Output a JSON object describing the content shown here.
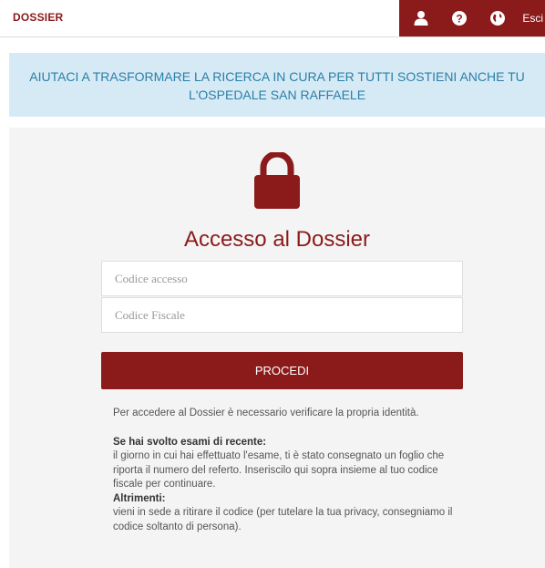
{
  "header": {
    "brand": "DOSSIER",
    "nav": {
      "user_icon": "user-icon",
      "help_icon": "question-circle-icon",
      "language_icon": "globe-icon",
      "exit_label": "Esci"
    }
  },
  "banner": {
    "text": "AIUTACI A TRASFORMARE LA RICERCA IN CURA PER TUTTI SOSTIENI ANCHE TU L'OSPEDALE SAN RAFFAELE"
  },
  "login": {
    "lock_icon": "padlock-icon",
    "title": "Accesso al Dossier",
    "access_code_placeholder": "Codice accesso",
    "access_code_value": "",
    "fiscal_code_placeholder": "Codice Fiscale",
    "fiscal_code_value": "",
    "submit_label": "PROCEDI"
  },
  "info": {
    "intro": "Per accedere al Dossier è necessario verificare la propria identità.",
    "recent_heading": "Se hai svolto esami di recente:",
    "recent_text": "il giorno in cui hai effettuato l'esame, ti è stato consegnato un foglio che riporta il numero del referto. Inseriscilo qui sopra insieme al tuo codice fiscale per continuare.",
    "otherwise_heading": "Altrimenti:",
    "otherwise_text": "vieni in sede a ritirare il codice (per tutelare la tua privacy, consegniamo il codice soltanto di persona)."
  },
  "colors": {
    "brand": "#8b1a1a",
    "banner_bg": "#d6eaf6",
    "banner_text": "#2a7fa6",
    "panel_bg": "#f4f4f4"
  }
}
